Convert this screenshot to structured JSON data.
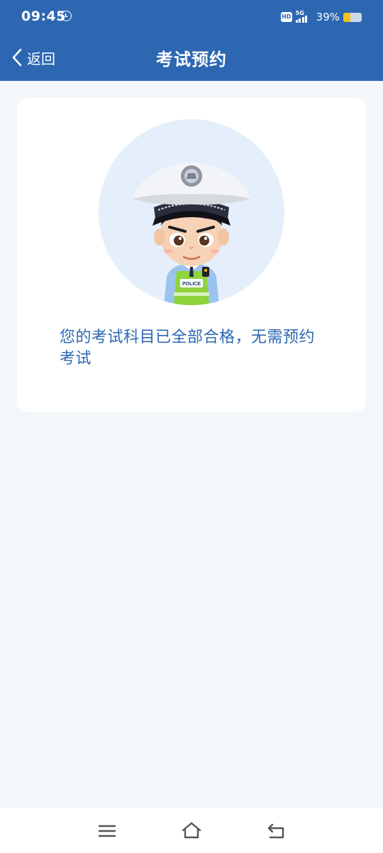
{
  "status_bar": {
    "time": "09:45",
    "network": "5G",
    "hd_label": "HD",
    "battery_percent": "39%",
    "battery_level": 0.39
  },
  "header": {
    "back_label": "返回",
    "title": "考试预约"
  },
  "card": {
    "message": "您的考试科目已全部合格，无需预约考试",
    "badge_text": "POLICE"
  },
  "colors": {
    "brand": "#2d67b2",
    "avatar_bg": "#e4effb",
    "page_bg": "#f3f7fa"
  },
  "system_nav": {
    "icons": [
      "menu-icon",
      "home-icon",
      "back-icon"
    ]
  }
}
